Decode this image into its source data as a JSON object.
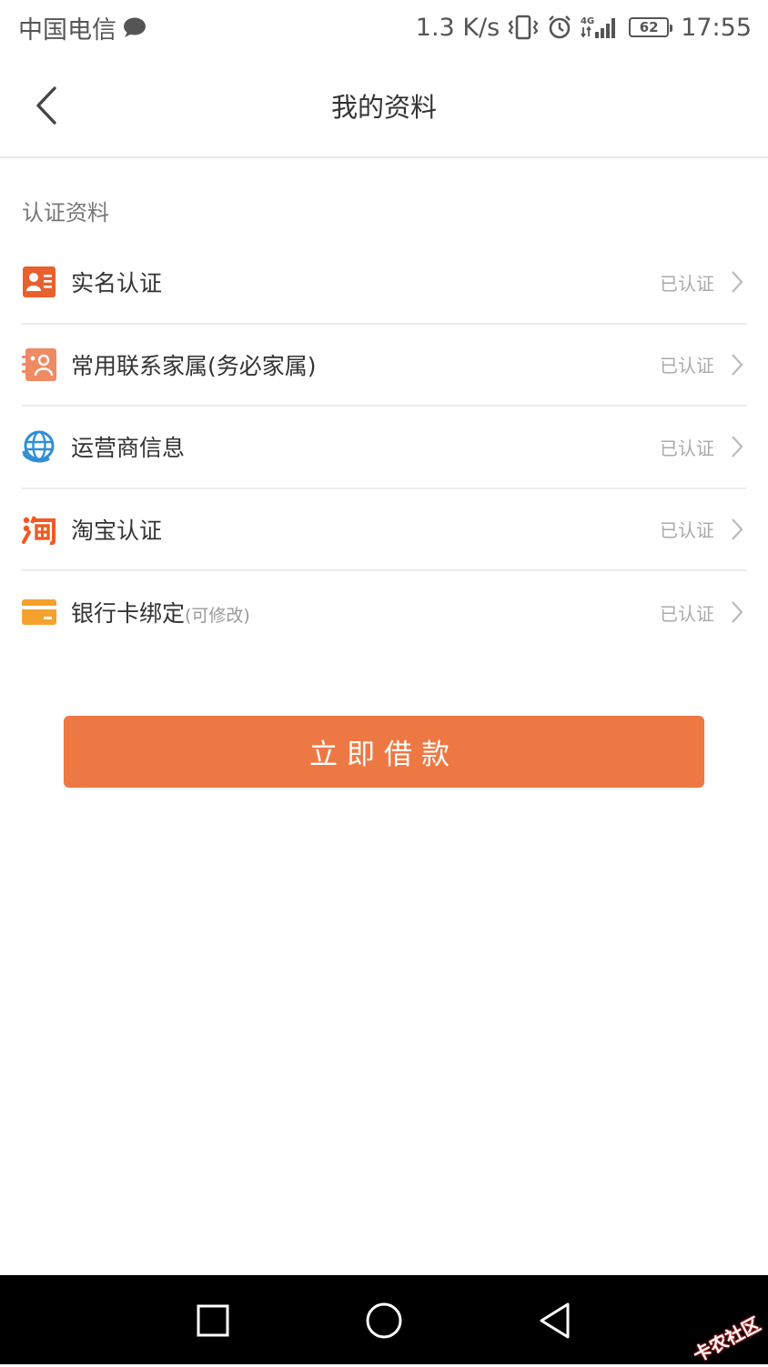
{
  "status_bar": {
    "carrier": "中国电信",
    "speed": "1.3 K/s",
    "battery": "62",
    "time": "17:55"
  },
  "header": {
    "title": "我的资料"
  },
  "section": {
    "label": "认证资料"
  },
  "items": [
    {
      "label": "实名认证",
      "sub": "",
      "status": "已认证",
      "icon": "id-card-icon"
    },
    {
      "label": "常用联系家属(务必家属)",
      "sub": "",
      "status": "已认证",
      "icon": "contacts-icon"
    },
    {
      "label": "运营商信息",
      "sub": "",
      "status": "已认证",
      "icon": "globe-icon"
    },
    {
      "label": "淘宝认证",
      "sub": "",
      "status": "已认证",
      "icon": "taobao-icon"
    },
    {
      "label": "银行卡绑定",
      "sub": "(可修改)",
      "status": "已认证",
      "icon": "bank-card-icon"
    }
  ],
  "primary_button": {
    "label": "立即借款"
  },
  "watermark": {
    "text": "卡农社区"
  },
  "colors": {
    "accent": "#ee7843",
    "id_icon": "#e8602c",
    "contacts_icon": "#f08a63",
    "globe_icon": "#2e8fd6",
    "taobao_icon": "#f05a22",
    "card_icon": "#f5a12d"
  }
}
